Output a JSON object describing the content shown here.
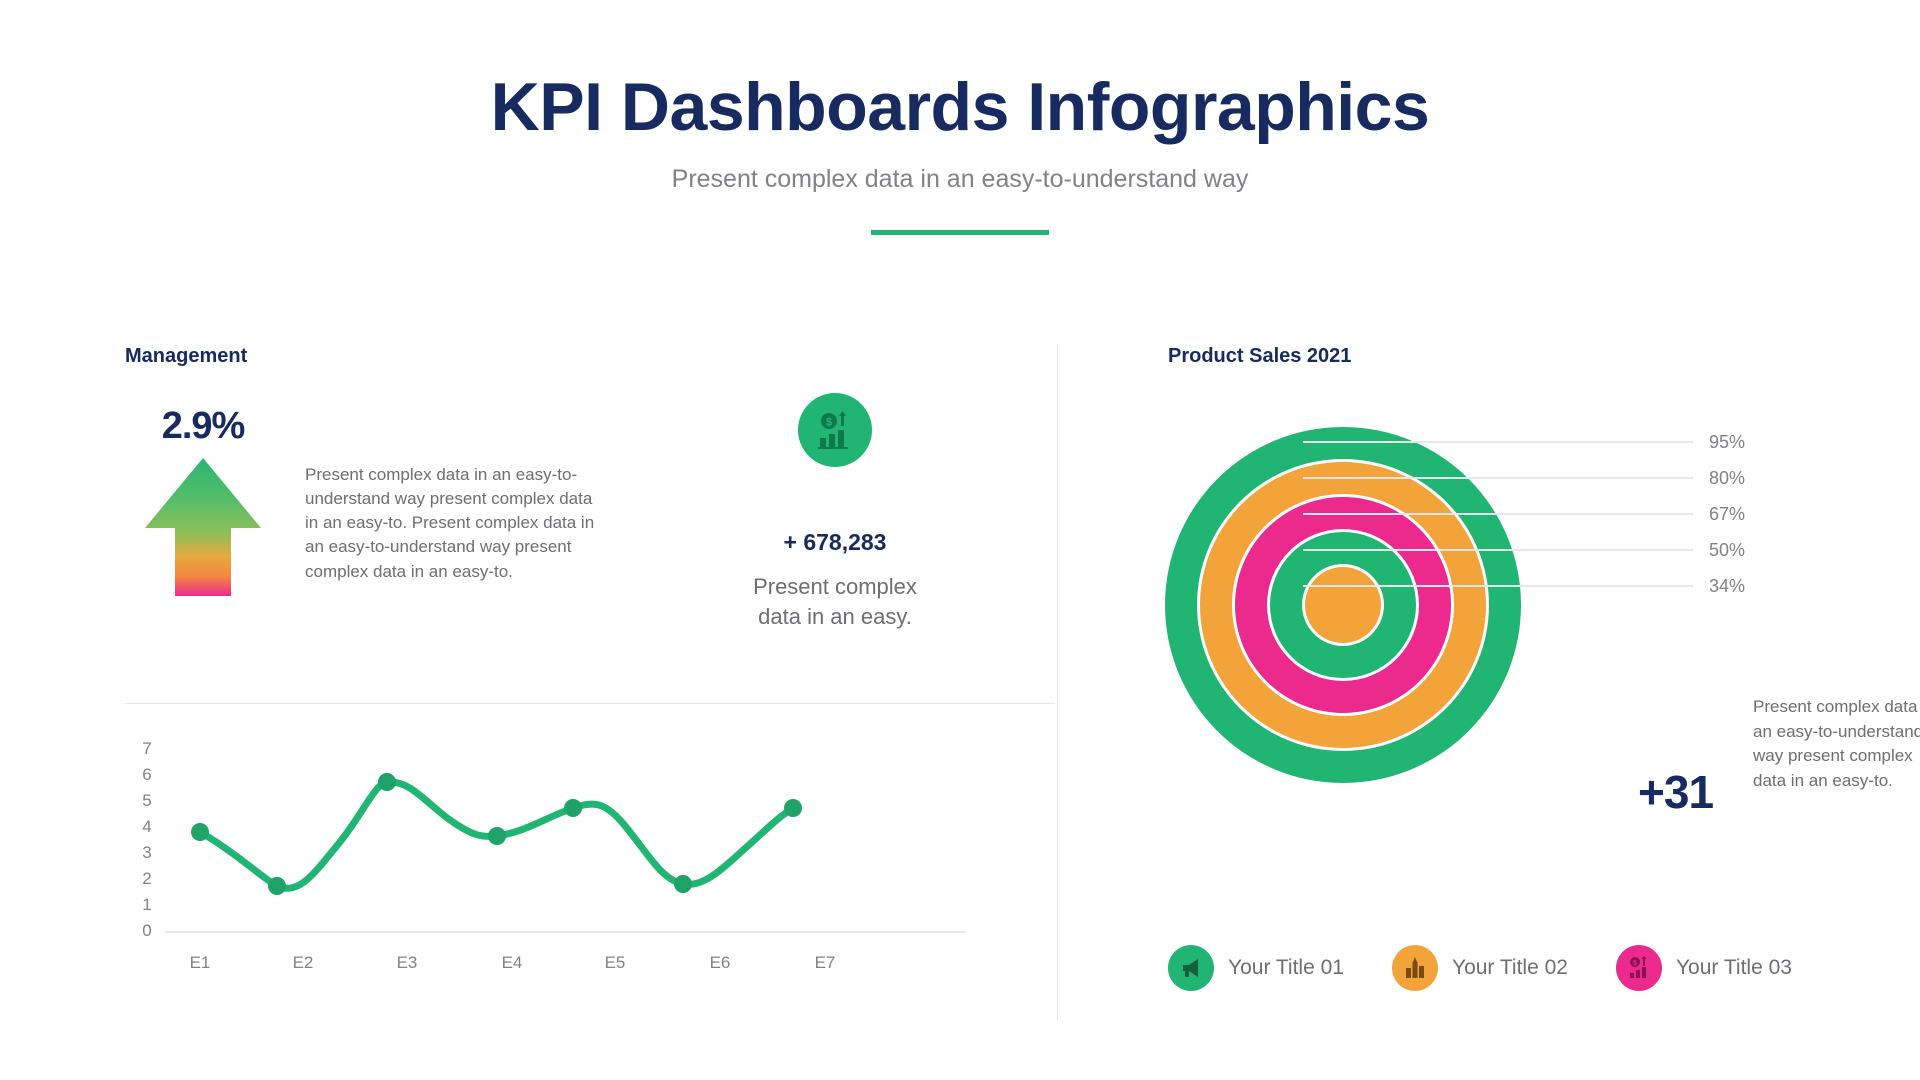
{
  "header": {
    "title": "KPI Dashboards Infographics",
    "subtitle": "Present complex data in an easy-to-understand way"
  },
  "colors": {
    "navy": "#172B61",
    "green": "#21B573",
    "orange": "#F2A43A",
    "pink": "#EC2A8E",
    "gray_text": "#6D6E71",
    "divider": "#E6E7E8"
  },
  "left_panel": {
    "title": "Management",
    "arrow_kpi": {
      "value": "2.9%",
      "icon": "up-arrow-icon",
      "gradient_from": "#2BB573",
      "gradient_mid": "#F2A43A",
      "gradient_to": "#EC2A8E"
    },
    "paragraph": "Present complex data in an easy-to-understand way present complex data in an easy-to. Present complex data in an easy-to-understand way present complex data in an easy-to.",
    "metric": {
      "icon": "money-growth-icon",
      "number": "+ 678,283",
      "caption": "Present complex data in an easy."
    }
  },
  "right_panel": {
    "title": "Product Sales 2021",
    "total": "+31",
    "note": "Present complex data in an easy-to-understand way present complex data in an easy-to.",
    "legend": [
      {
        "label": "Your Title 01",
        "color": "#21B573",
        "icon": "megaphone-icon"
      },
      {
        "label": "Your Title 02",
        "color": "#F2A43A",
        "icon": "buildings-icon"
      },
      {
        "label": "Your Title 03",
        "color": "#EC2A8E",
        "icon": "money-chart-icon"
      }
    ]
  },
  "chart_data": [
    {
      "type": "line",
      "title": "Management",
      "categories": [
        "E1",
        "E2",
        "E3",
        "E4",
        "E5",
        "E6",
        "E7"
      ],
      "values": [
        4.3,
        2.4,
        6.3,
        4.4,
        5.2,
        2.6,
        5.2
      ],
      "ylim": [
        0,
        7
      ],
      "yticks": [
        "0",
        "1",
        "2",
        "3",
        "4",
        "5",
        "6",
        "7"
      ],
      "xlabel": "",
      "ylabel": "",
      "grid": false,
      "legend": "none",
      "series_color": "#21B573",
      "smooth": true,
      "markers": true
    },
    {
      "type": "pie",
      "title": "Product Sales 2021",
      "subtype": "concentric-rings",
      "labels": [
        "95%",
        "80%",
        "67%",
        "50%",
        "34%"
      ],
      "values": [
        95,
        80,
        67,
        50,
        34
      ],
      "colors": [
        "#21B573",
        "#F2A43A",
        "#EC2A8E",
        "#21B573",
        "#F2A43A"
      ],
      "legend": "bottom",
      "legend_entries": [
        "Your Title 01",
        "Your Title 02",
        "Your Title 03"
      ],
      "annotation": "+31"
    }
  ]
}
